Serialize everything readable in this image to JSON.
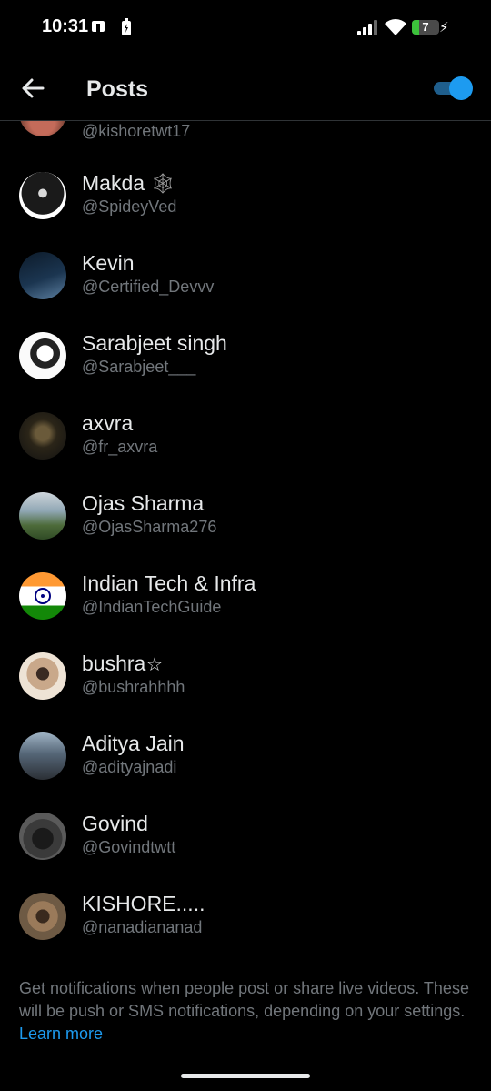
{
  "status_bar": {
    "time": "10:31",
    "battery": "7"
  },
  "header": {
    "title": "Posts",
    "toggle_on": true
  },
  "partial_row": {
    "handle": "@kishoretwt17"
  },
  "accounts": [
    {
      "name": "Makda",
      "name_suffix": "🕸",
      "handle": "@SpideyVed",
      "avatar": "spider-avatar"
    },
    {
      "name": "Kevin",
      "name_suffix": "",
      "handle": "@Certified_Devvv",
      "avatar": "laptop-avatar"
    },
    {
      "name": "Sarabjeet singh",
      "name_suffix": "",
      "handle": "@Sarabjeet___",
      "avatar": "sketch-avatar"
    },
    {
      "name": "axvra",
      "name_suffix": "",
      "handle": "@fr_axvra",
      "avatar": "dark-portrait-avatar"
    },
    {
      "name": "Ojas Sharma",
      "name_suffix": "",
      "handle": "@OjasSharma276",
      "avatar": "outdoor-avatar"
    },
    {
      "name": "Indian Tech & Infra",
      "name_suffix": "",
      "handle": "@IndianTechGuide",
      "avatar": "india-flag-avatar"
    },
    {
      "name": "bushra",
      "name_suffix": "☆",
      "handle": "@bushrahhhh",
      "avatar": "portrait-avatar"
    },
    {
      "name": "Aditya Jain",
      "name_suffix": "",
      "handle": "@adityajnadi",
      "avatar": "mountain-avatar"
    },
    {
      "name": "Govind",
      "name_suffix": "",
      "handle": "@Govindtwtt",
      "avatar": "batman-avatar"
    },
    {
      "name": "KISHORE.....",
      "name_suffix": "",
      "handle": "@nanadiananad",
      "avatar": "sunglasses-avatar"
    }
  ],
  "footer": {
    "text": "Get notifications when people post or share live videos. These will be push or SMS notifications, depending on your settings.",
    "link": "Learn more"
  },
  "colors": {
    "accent": "#1d9bf0",
    "background": "#000000",
    "secondary_text": "#71767b"
  }
}
